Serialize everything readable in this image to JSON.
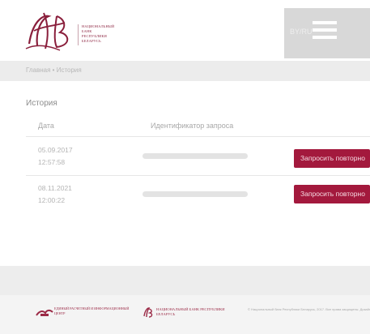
{
  "header": {
    "logo_lines": [
      "Национальный",
      "банк",
      "Республики",
      "Беларусь"
    ],
    "lang_label": "BY/RU",
    "brand_color": "#8a1f3c"
  },
  "breadcrumb": "Главная • История",
  "page": {
    "title": "История",
    "columns": {
      "date": "Дата",
      "request_id": "Идентификатор запроса"
    }
  },
  "rows": [
    {
      "date": "05.09.2017",
      "time": "12:57:58",
      "action_label": "Запросить повторно"
    },
    {
      "date": "08.11.2021",
      "time": "12:00:22",
      "action_label": "Запросить повторно"
    }
  ],
  "footer": {
    "partner1": "Единый расчетный и информационный центр",
    "bank": "Национальный банк Республики Беларусь",
    "copyright": "© Национальный банк Республики Беларусь, 2017. Все права защищены. Дизайн и поддержка: ЕРИП"
  },
  "colors": {
    "accent": "#a3193d",
    "breadcrumb_bg": "#ececec",
    "footer_bg": "#f4f4f4"
  }
}
